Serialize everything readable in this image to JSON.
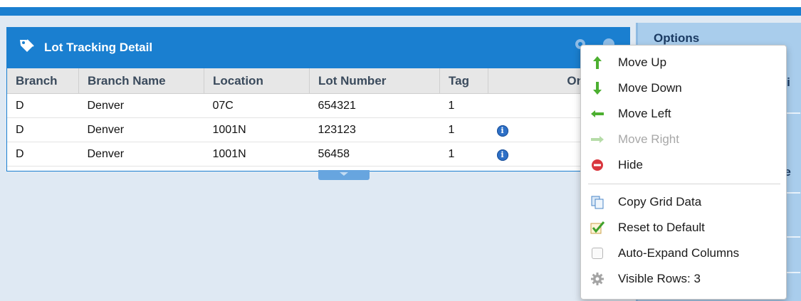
{
  "options_panel": {
    "header": "Options",
    "frag_1": "ivi",
    "frag_2": "de"
  },
  "grid": {
    "title": "Lot Tracking Detail",
    "columns": [
      "Branch",
      "Branch Name",
      "Location",
      "Lot Number",
      "Tag",
      "On"
    ],
    "rows": [
      {
        "branch": "D",
        "branch_name": "Denver",
        "location": "07C",
        "lot_number": "654321",
        "tag": "1",
        "info": false
      },
      {
        "branch": "D",
        "branch_name": "Denver",
        "location": "1001N",
        "lot_number": "123123",
        "tag": "1",
        "info": true
      },
      {
        "branch": "D",
        "branch_name": "Denver",
        "location": "1001N",
        "lot_number": "56458",
        "tag": "1",
        "info": true
      }
    ],
    "info_glyph": "i"
  },
  "context_menu": {
    "items": [
      {
        "label": "Move Up",
        "icon": "arrow-up-green-icon",
        "enabled": true
      },
      {
        "label": "Move Down",
        "icon": "arrow-down-green-icon",
        "enabled": true
      },
      {
        "label": "Move Left",
        "icon": "arrow-left-green-icon",
        "enabled": true
      },
      {
        "label": "Move Right",
        "icon": "arrow-right-green-icon",
        "enabled": false
      },
      {
        "label": "Hide",
        "icon": "hide-red-icon",
        "enabled": true
      },
      {
        "label": "Copy Grid Data",
        "icon": "copy-icon",
        "enabled": true
      },
      {
        "label": "Reset to Default",
        "icon": "checkmark-icon",
        "enabled": true
      },
      {
        "label": "Auto-Expand Columns",
        "icon": "checkbox-icon",
        "enabled": true,
        "checked": false
      },
      {
        "label": "Visible Rows: 3",
        "icon": "gear-icon",
        "enabled": true
      }
    ]
  },
  "colors": {
    "accent_blue": "#1a7fd0",
    "arrow_green": "#4caf30",
    "hide_red": "#d9363e",
    "disabled_text": "#a8a8a8"
  }
}
